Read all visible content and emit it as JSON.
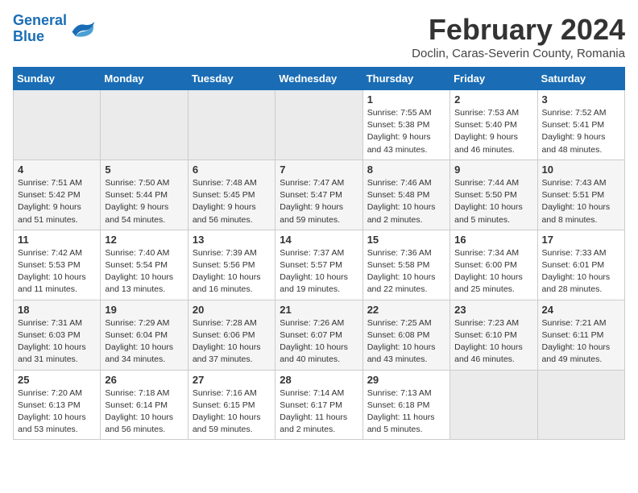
{
  "logo": {
    "text_general": "General",
    "text_blue": "Blue",
    "bird_color": "#1a6db5"
  },
  "title": "February 2024",
  "subtitle": "Doclin, Caras-Severin County, Romania",
  "header_color": "#1a6db5",
  "days_of_week": [
    "Sunday",
    "Monday",
    "Tuesday",
    "Wednesday",
    "Thursday",
    "Friday",
    "Saturday"
  ],
  "weeks": [
    {
      "cells": [
        {
          "empty": true
        },
        {
          "empty": true
        },
        {
          "empty": true
        },
        {
          "empty": true
        },
        {
          "day": 1,
          "sunrise": "7:55 AM",
          "sunset": "5:38 PM",
          "daylight": "9 hours and 43 minutes."
        },
        {
          "day": 2,
          "sunrise": "7:53 AM",
          "sunset": "5:40 PM",
          "daylight": "9 hours and 46 minutes."
        },
        {
          "day": 3,
          "sunrise": "7:52 AM",
          "sunset": "5:41 PM",
          "daylight": "9 hours and 48 minutes."
        }
      ]
    },
    {
      "cells": [
        {
          "day": 4,
          "sunrise": "7:51 AM",
          "sunset": "5:42 PM",
          "daylight": "9 hours and 51 minutes."
        },
        {
          "day": 5,
          "sunrise": "7:50 AM",
          "sunset": "5:44 PM",
          "daylight": "9 hours and 54 minutes."
        },
        {
          "day": 6,
          "sunrise": "7:48 AM",
          "sunset": "5:45 PM",
          "daylight": "9 hours and 56 minutes."
        },
        {
          "day": 7,
          "sunrise": "7:47 AM",
          "sunset": "5:47 PM",
          "daylight": "9 hours and 59 minutes."
        },
        {
          "day": 8,
          "sunrise": "7:46 AM",
          "sunset": "5:48 PM",
          "daylight": "10 hours and 2 minutes."
        },
        {
          "day": 9,
          "sunrise": "7:44 AM",
          "sunset": "5:50 PM",
          "daylight": "10 hours and 5 minutes."
        },
        {
          "day": 10,
          "sunrise": "7:43 AM",
          "sunset": "5:51 PM",
          "daylight": "10 hours and 8 minutes."
        }
      ]
    },
    {
      "cells": [
        {
          "day": 11,
          "sunrise": "7:42 AM",
          "sunset": "5:53 PM",
          "daylight": "10 hours and 11 minutes."
        },
        {
          "day": 12,
          "sunrise": "7:40 AM",
          "sunset": "5:54 PM",
          "daylight": "10 hours and 13 minutes."
        },
        {
          "day": 13,
          "sunrise": "7:39 AM",
          "sunset": "5:56 PM",
          "daylight": "10 hours and 16 minutes."
        },
        {
          "day": 14,
          "sunrise": "7:37 AM",
          "sunset": "5:57 PM",
          "daylight": "10 hours and 19 minutes."
        },
        {
          "day": 15,
          "sunrise": "7:36 AM",
          "sunset": "5:58 PM",
          "daylight": "10 hours and 22 minutes."
        },
        {
          "day": 16,
          "sunrise": "7:34 AM",
          "sunset": "6:00 PM",
          "daylight": "10 hours and 25 minutes."
        },
        {
          "day": 17,
          "sunrise": "7:33 AM",
          "sunset": "6:01 PM",
          "daylight": "10 hours and 28 minutes."
        }
      ]
    },
    {
      "cells": [
        {
          "day": 18,
          "sunrise": "7:31 AM",
          "sunset": "6:03 PM",
          "daylight": "10 hours and 31 minutes."
        },
        {
          "day": 19,
          "sunrise": "7:29 AM",
          "sunset": "6:04 PM",
          "daylight": "10 hours and 34 minutes."
        },
        {
          "day": 20,
          "sunrise": "7:28 AM",
          "sunset": "6:06 PM",
          "daylight": "10 hours and 37 minutes."
        },
        {
          "day": 21,
          "sunrise": "7:26 AM",
          "sunset": "6:07 PM",
          "daylight": "10 hours and 40 minutes."
        },
        {
          "day": 22,
          "sunrise": "7:25 AM",
          "sunset": "6:08 PM",
          "daylight": "10 hours and 43 minutes."
        },
        {
          "day": 23,
          "sunrise": "7:23 AM",
          "sunset": "6:10 PM",
          "daylight": "10 hours and 46 minutes."
        },
        {
          "day": 24,
          "sunrise": "7:21 AM",
          "sunset": "6:11 PM",
          "daylight": "10 hours and 49 minutes."
        }
      ]
    },
    {
      "cells": [
        {
          "day": 25,
          "sunrise": "7:20 AM",
          "sunset": "6:13 PM",
          "daylight": "10 hours and 53 minutes."
        },
        {
          "day": 26,
          "sunrise": "7:18 AM",
          "sunset": "6:14 PM",
          "daylight": "10 hours and 56 minutes."
        },
        {
          "day": 27,
          "sunrise": "7:16 AM",
          "sunset": "6:15 PM",
          "daylight": "10 hours and 59 minutes."
        },
        {
          "day": 28,
          "sunrise": "7:14 AM",
          "sunset": "6:17 PM",
          "daylight": "11 hours and 2 minutes."
        },
        {
          "day": 29,
          "sunrise": "7:13 AM",
          "sunset": "6:18 PM",
          "daylight": "11 hours and 5 minutes."
        },
        {
          "empty": true
        },
        {
          "empty": true
        }
      ]
    }
  ],
  "labels": {
    "sunrise": "Sunrise:",
    "sunset": "Sunset:",
    "daylight": "Daylight:"
  }
}
